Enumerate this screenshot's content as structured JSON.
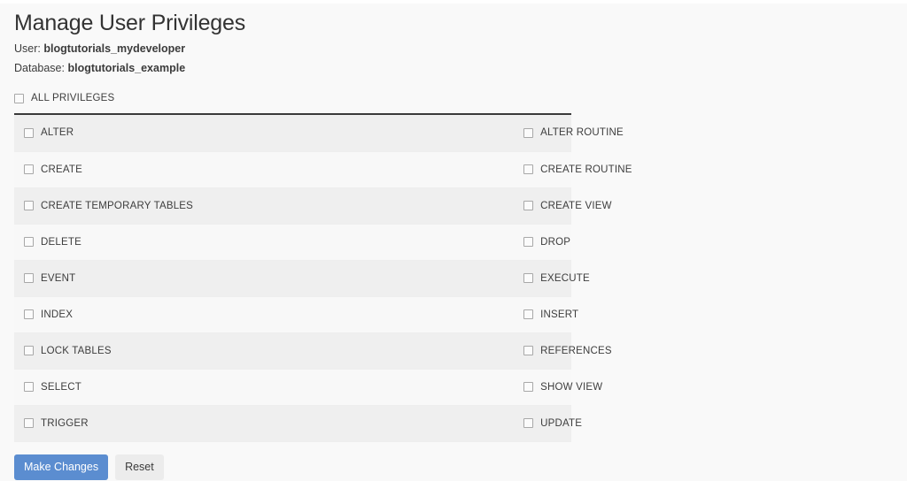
{
  "page": {
    "title": "Manage User Privileges",
    "user_label": "User:",
    "user_value": "blogtutorials_mydeveloper",
    "database_label": "Database:",
    "database_value": "blogtutorials_example"
  },
  "all_privileges": {
    "label": "ALL PRIVILEGES",
    "checked": false
  },
  "privileges": [
    {
      "left": "ALTER",
      "left_checked": false,
      "right": "ALTER ROUTINE",
      "right_checked": false
    },
    {
      "left": "CREATE",
      "left_checked": false,
      "right": "CREATE ROUTINE",
      "right_checked": false
    },
    {
      "left": "CREATE TEMPORARY TABLES",
      "left_checked": false,
      "right": "CREATE VIEW",
      "right_checked": false
    },
    {
      "left": "DELETE",
      "left_checked": false,
      "right": "DROP",
      "right_checked": false
    },
    {
      "left": "EVENT",
      "left_checked": false,
      "right": "EXECUTE",
      "right_checked": false
    },
    {
      "left": "INDEX",
      "left_checked": false,
      "right": "INSERT",
      "right_checked": false
    },
    {
      "left": "LOCK TABLES",
      "left_checked": false,
      "right": "REFERENCES",
      "right_checked": false
    },
    {
      "left": "SELECT",
      "left_checked": false,
      "right": "SHOW VIEW",
      "right_checked": false
    },
    {
      "left": "TRIGGER",
      "left_checked": false,
      "right": "UPDATE",
      "right_checked": false
    }
  ],
  "actions": {
    "submit_label": "Make Changes",
    "reset_label": "Reset"
  },
  "colors": {
    "primary_button": "#5b8dd0",
    "secondary_button": "#ececec",
    "stripe_row": "#efefef",
    "plain_row": "#f8f8f8",
    "page_background": "#f9f9f9",
    "divider": "#3a3a3a",
    "text": "#333333"
  }
}
